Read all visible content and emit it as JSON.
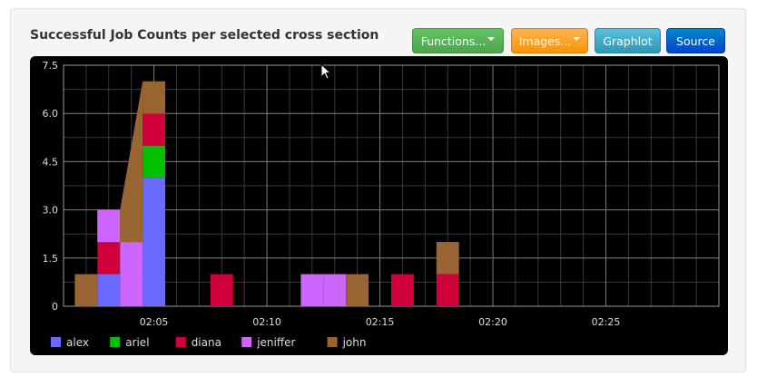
{
  "title": "Successful Job Counts per selected cross section",
  "toolbar": {
    "functions_label": "Functions...",
    "images_label": "Images...",
    "graphlot_label": "Graphlot",
    "source_label": "Source"
  },
  "colors": {
    "alex": "#6a6aff",
    "ariel": "#00c000",
    "diana": "#d0003a",
    "jeniffer": "#cc66ff",
    "john": "#996633"
  },
  "chart_data": {
    "type": "area",
    "stacked": true,
    "y_ticks": [
      "0",
      "1.5",
      "3.0",
      "4.5",
      "6.0",
      "7.5"
    ],
    "ylim": [
      0,
      7.5
    ],
    "x_ticks": [
      "02:05",
      "02:10",
      "02:15",
      "02:20",
      "02:25"
    ],
    "x_unit_minutes": [
      5,
      10,
      15,
      20,
      25
    ],
    "xlim_minutes": [
      1,
      30
    ],
    "grid": true,
    "legend_position": "bottom",
    "x_minutes": [
      2,
      3,
      4,
      5,
      6,
      7,
      8,
      9,
      10,
      11,
      12,
      13,
      14,
      15,
      16,
      17,
      18,
      19
    ],
    "series": [
      {
        "name": "alex",
        "values": [
          0,
          1,
          0,
          4,
          0,
          0,
          0,
          0,
          0,
          0,
          0,
          0,
          0,
          0,
          0,
          0,
          0,
          0
        ]
      },
      {
        "name": "ariel",
        "values": [
          0,
          0,
          0,
          1,
          0,
          0,
          0,
          0,
          0,
          0,
          0,
          0,
          0,
          0,
          0,
          0,
          0,
          0
        ]
      },
      {
        "name": "diana",
        "values": [
          0,
          1,
          0,
          1,
          0,
          0,
          1,
          0,
          0,
          0,
          0,
          0,
          0,
          0,
          1,
          0,
          1,
          0
        ]
      },
      {
        "name": "jeniffer",
        "values": [
          0,
          1,
          2,
          0,
          0,
          0,
          0,
          0,
          0,
          0,
          1,
          1,
          0,
          0,
          0,
          0,
          0,
          0
        ]
      },
      {
        "name": "john",
        "values": [
          1,
          0,
          1,
          1,
          0,
          0,
          0,
          0,
          0,
          0,
          0,
          0,
          1,
          0,
          0,
          0,
          1,
          0
        ]
      }
    ]
  }
}
